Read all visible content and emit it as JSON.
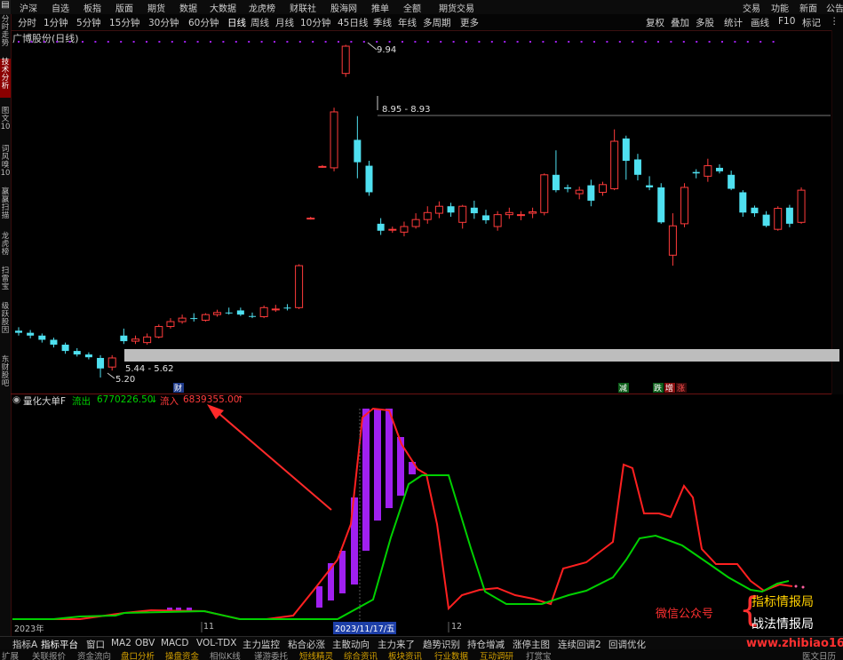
{
  "top_menu": {
    "left": [
      "沪深",
      "自选",
      "板指",
      "版面",
      "期货",
      "数据",
      "大数据",
      "龙虎榜",
      "财联社",
      "股海网",
      "推单",
      "全额",
      "期货交易"
    ],
    "right": [
      "交易",
      "功能",
      "新面",
      "公告"
    ]
  },
  "periods": {
    "items": [
      "分时",
      "1分钟",
      "5分钟",
      "15分钟",
      "30分钟",
      "60分钟",
      "日线",
      "周线",
      "月线",
      "10分钟",
      "45日线",
      "季线",
      "年线",
      "多周期",
      "更多"
    ],
    "active": "日线",
    "tools": [
      "复权",
      "叠加",
      "多股",
      "统计",
      "画线",
      "F10",
      "标记",
      "⋮"
    ]
  },
  "left_rail": [
    {
      "text": "分时走势",
      "red": false
    },
    {
      "text": "技术分析",
      "red": true
    },
    {
      "text": "图文10",
      "red": false
    },
    {
      "text": "词风 嗅10",
      "red": false
    },
    {
      "text": "赢赢 扫描",
      "red": false
    },
    {
      "text": "龙虎榜",
      "red": false
    },
    {
      "text": "扫雷宝",
      "red": false
    },
    {
      "text": "级跃 股因",
      "red": false
    },
    {
      "text": "东财 股吧",
      "red": false
    }
  ],
  "chart": {
    "title": "广博股份(日线)",
    "high_label": "9.94",
    "line_label": "8.95 - 8.93",
    "gray_label": "5.44 - 5.62",
    "low_label": "5.20",
    "candles": [
      {
        "o": 5.87,
        "c": 5.84,
        "h": 5.92,
        "l": 5.8
      },
      {
        "o": 5.84,
        "c": 5.8,
        "h": 5.88,
        "l": 5.76
      },
      {
        "o": 5.8,
        "c": 5.74,
        "h": 5.83,
        "l": 5.7
      },
      {
        "o": 5.74,
        "c": 5.67,
        "h": 5.77,
        "l": 5.63
      },
      {
        "o": 5.67,
        "c": 5.58,
        "h": 5.7,
        "l": 5.54
      },
      {
        "o": 5.58,
        "c": 5.53,
        "h": 5.62,
        "l": 5.5
      },
      {
        "o": 5.53,
        "c": 5.49,
        "h": 5.56,
        "l": 5.46
      },
      {
        "o": 5.48,
        "c": 5.33,
        "h": 5.52,
        "l": 5.2
      },
      {
        "o": 5.35,
        "c": 5.48,
        "h": 5.52,
        "l": 5.3
      },
      {
        "o": 5.8,
        "c": 5.72,
        "h": 5.9,
        "l": 5.68
      },
      {
        "o": 5.72,
        "c": 5.75,
        "h": 5.8,
        "l": 5.68
      },
      {
        "o": 5.7,
        "c": 5.78,
        "h": 5.83,
        "l": 5.67
      },
      {
        "o": 5.78,
        "c": 5.93,
        "h": 5.96,
        "l": 5.76
      },
      {
        "o": 5.93,
        "c": 6.0,
        "h": 6.05,
        "l": 5.9
      },
      {
        "o": 6.0,
        "c": 6.05,
        "h": 6.1,
        "l": 5.97
      },
      {
        "o": 6.05,
        "c": 6.04,
        "h": 6.12,
        "l": 6.0
      },
      {
        "o": 6.02,
        "c": 6.1,
        "h": 6.12,
        "l": 6.0
      },
      {
        "o": 6.1,
        "c": 6.13,
        "h": 6.17,
        "l": 6.07
      },
      {
        "o": 6.13,
        "c": 6.12,
        "h": 6.2,
        "l": 6.1
      },
      {
        "o": 6.16,
        "c": 6.1,
        "h": 6.2,
        "l": 6.08
      },
      {
        "o": 6.08,
        "c": 6.07,
        "h": 6.13,
        "l": 6.05
      },
      {
        "o": 6.07,
        "c": 6.2,
        "h": 6.23,
        "l": 6.05
      },
      {
        "o": 6.18,
        "c": 6.18,
        "h": 6.24,
        "l": 6.14
      },
      {
        "o": 6.2,
        "c": 6.19,
        "h": 6.25,
        "l": 6.16
      },
      {
        "o": 6.2,
        "c": 6.8,
        "h": 6.82,
        "l": 6.18
      },
      {
        "o": 7.48,
        "c": 7.48,
        "h": 7.5,
        "l": 7.46
      },
      {
        "o": 8.22,
        "c": 8.22,
        "h": 8.24,
        "l": 8.2
      },
      {
        "o": 8.2,
        "c": 9.0,
        "h": 9.06,
        "l": 8.15
      },
      {
        "o": 9.55,
        "c": 9.94,
        "h": 9.96,
        "l": 9.5
      },
      {
        "o": 8.6,
        "c": 8.28,
        "h": 8.94,
        "l": 8.05
      },
      {
        "o": 8.23,
        "c": 7.85,
        "h": 8.3,
        "l": 7.8
      },
      {
        "o": 7.4,
        "c": 7.3,
        "h": 7.48,
        "l": 7.24
      },
      {
        "o": 7.32,
        "c": 7.32,
        "h": 7.36,
        "l": 7.27
      },
      {
        "o": 7.28,
        "c": 7.36,
        "h": 7.43,
        "l": 7.22
      },
      {
        "o": 7.36,
        "c": 7.46,
        "h": 7.55,
        "l": 7.33
      },
      {
        "o": 7.46,
        "c": 7.56,
        "h": 7.65,
        "l": 7.4
      },
      {
        "o": 7.55,
        "c": 7.65,
        "h": 7.72,
        "l": 7.48
      },
      {
        "o": 7.65,
        "c": 7.56,
        "h": 7.7,
        "l": 7.5
      },
      {
        "o": 7.42,
        "c": 7.65,
        "h": 7.67,
        "l": 7.33
      },
      {
        "o": 7.63,
        "c": 7.55,
        "h": 7.73,
        "l": 7.47
      },
      {
        "o": 7.52,
        "c": 7.45,
        "h": 7.6,
        "l": 7.4
      },
      {
        "o": 7.36,
        "c": 7.53,
        "h": 7.58,
        "l": 7.3
      },
      {
        "o": 7.53,
        "c": 7.56,
        "h": 7.63,
        "l": 7.47
      },
      {
        "o": 7.53,
        "c": 7.53,
        "h": 7.58,
        "l": 7.45
      },
      {
        "o": 7.55,
        "c": 7.57,
        "h": 7.63,
        "l": 7.48
      },
      {
        "o": 7.56,
        "c": 8.1,
        "h": 8.12,
        "l": 7.52
      },
      {
        "o": 8.1,
        "c": 7.88,
        "h": 8.45,
        "l": 7.85
      },
      {
        "o": 7.92,
        "c": 7.9,
        "h": 7.96,
        "l": 7.85
      },
      {
        "o": 7.83,
        "c": 7.88,
        "h": 7.93,
        "l": 7.75
      },
      {
        "o": 7.95,
        "c": 7.73,
        "h": 8.03,
        "l": 7.65
      },
      {
        "o": 7.85,
        "c": 7.96,
        "h": 8.0,
        "l": 7.8
      },
      {
        "o": 7.9,
        "c": 8.58,
        "h": 8.75,
        "l": 7.88
      },
      {
        "o": 8.62,
        "c": 8.3,
        "h": 8.66,
        "l": 8.03
      },
      {
        "o": 8.32,
        "c": 8.1,
        "h": 8.4,
        "l": 8.02
      },
      {
        "o": 7.95,
        "c": 7.92,
        "h": 8.08,
        "l": 7.88
      },
      {
        "o": 7.92,
        "c": 7.42,
        "h": 7.98,
        "l": 7.4
      },
      {
        "o": 6.95,
        "c": 7.37,
        "h": 7.55,
        "l": 6.8
      },
      {
        "o": 7.4,
        "c": 7.92,
        "h": 7.98,
        "l": 7.35
      },
      {
        "o": 8.14,
        "c": 8.12,
        "h": 8.18,
        "l": 8.05
      },
      {
        "o": 8.08,
        "c": 8.23,
        "h": 8.33,
        "l": 8.0
      },
      {
        "o": 8.2,
        "c": 8.15,
        "h": 8.25,
        "l": 8.12
      },
      {
        "o": 8.1,
        "c": 7.9,
        "h": 8.16,
        "l": 7.88
      },
      {
        "o": 7.85,
        "c": 7.56,
        "h": 7.88,
        "l": 7.5
      },
      {
        "o": 7.63,
        "c": 7.55,
        "h": 7.66,
        "l": 7.5
      },
      {
        "o": 7.53,
        "c": 7.37,
        "h": 7.58,
        "l": 7.35
      },
      {
        "o": 7.32,
        "c": 7.62,
        "h": 7.65,
        "l": 7.3
      },
      {
        "o": 7.63,
        "c": 7.4,
        "h": 7.67,
        "l": 7.35
      },
      {
        "o": 7.42,
        "c": 7.88,
        "h": 7.92,
        "l": 7.4
      }
    ],
    "markers": {
      "cai": "财",
      "jian": "减",
      "jie": "跌",
      "zeng": "增",
      "zhang": "涨"
    }
  },
  "indicator": {
    "name": "量化大单F",
    "outflow_label": "流出",
    "outflow_value": "6770226.50",
    "inflow_label": "流入",
    "inflow_value": "6839355.00",
    "date_tags": {
      "year": "2023年",
      "m11": "11",
      "m12": "12",
      "cursor": "2023/11/17/五"
    }
  },
  "bottom_tabs": {
    "items": [
      "指标A",
      "指标平台",
      "窗口",
      "MA2",
      "OBV",
      "MACD",
      "VOL-TDX",
      "主力监控",
      "粘合必涨",
      "主散动向",
      "主力来了",
      "趋势识别",
      "持仓增减",
      "涨停主图",
      "连续回调2",
      "回调优化"
    ],
    "selected": "指标平台"
  },
  "bottom_status": {
    "items": [
      "扩展",
      "关联报价",
      "资金流向",
      "盘口分析",
      "操盘资金",
      "相似K线",
      "谨游委托",
      "短线精灵",
      "综合资讯",
      "板块资讯",
      "行业数据",
      "互动调研",
      "打赏宝"
    ],
    "highlighted": [
      "盘口分析",
      "操盘资金",
      "短线精灵",
      "综合资讯",
      "板块资讯",
      "行业数据",
      "互动调研"
    ],
    "right_label": "医文日历"
  },
  "watermark": {
    "wechat": "微信公众号",
    "line1": "指标情报局",
    "line2": "战法情报局",
    "site": "www.zhibiao168.com"
  },
  "colors": {
    "up": "#ff3b3b",
    "down": "#4fe0f0",
    "bg": "#000000",
    "purple": "#a020f0",
    "green": "#00d000",
    "accent": "#ff2a2a"
  }
}
